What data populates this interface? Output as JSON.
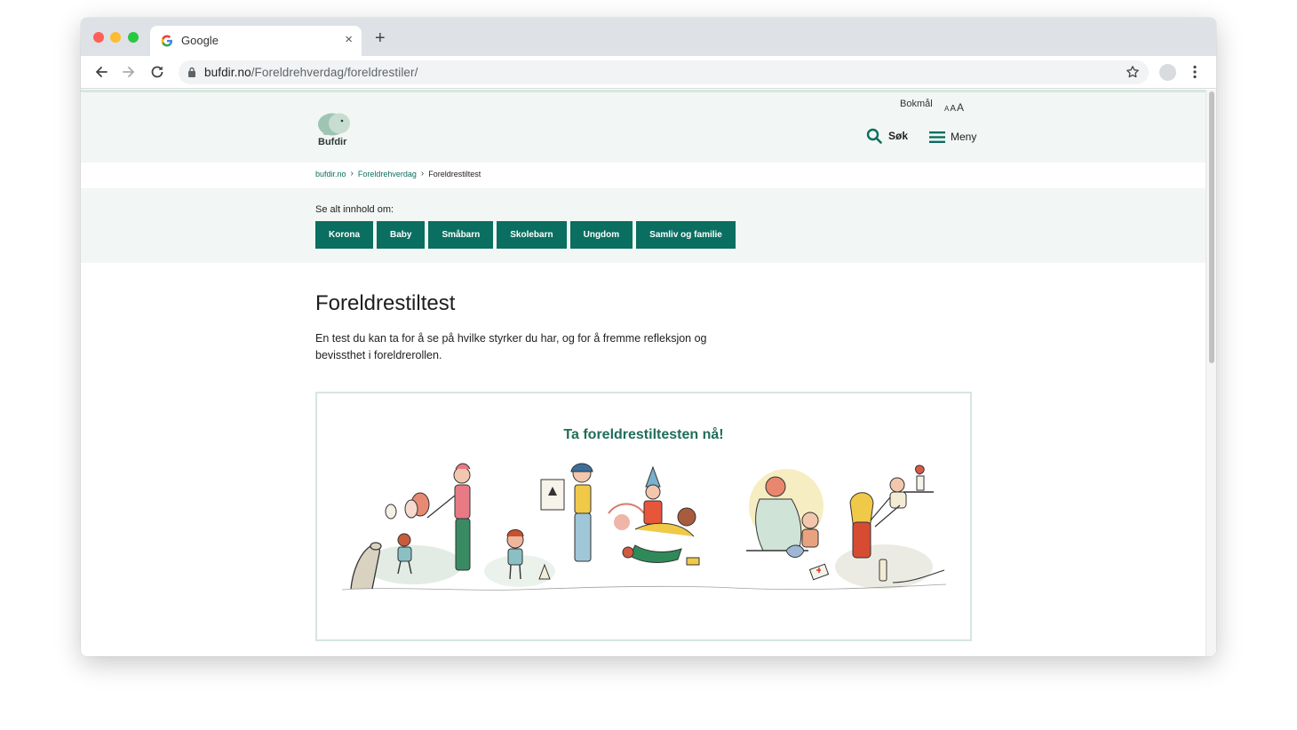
{
  "browser": {
    "tab_title": "Google",
    "tab_close": "×",
    "new_tab": "+",
    "url_domain": "bufdir.no",
    "url_path": "/Foreldrehverdag/foreldrestiler/"
  },
  "header": {
    "logo_text": "Bufdir",
    "language": "Bokmål",
    "font_sizes": [
      "A",
      "A",
      "A"
    ],
    "search_label": "Søk",
    "menu_label": "Meny"
  },
  "breadcrumb": {
    "items": [
      "bufdir.no",
      "Foreldrehverdag"
    ],
    "separator": "›",
    "current": "Foreldrestiltest"
  },
  "topics": {
    "label": "Se alt innhold om:",
    "buttons": [
      "Korona",
      "Baby",
      "Småbarn",
      "Skolebarn",
      "Ungdom",
      "Samliv og familie"
    ]
  },
  "main": {
    "title": "Foreldrestiltest",
    "intro": "En test du kan ta for å se på hvilke styrker du har, og for å fremme refleksjon og bevissthet i foreldrerollen."
  },
  "cta": {
    "title": "Ta foreldrestiltesten nå!"
  },
  "colors": {
    "brand_green": "#0a6e60",
    "cta_green": "#1f6e58",
    "header_bg": "#f2f6f4"
  }
}
